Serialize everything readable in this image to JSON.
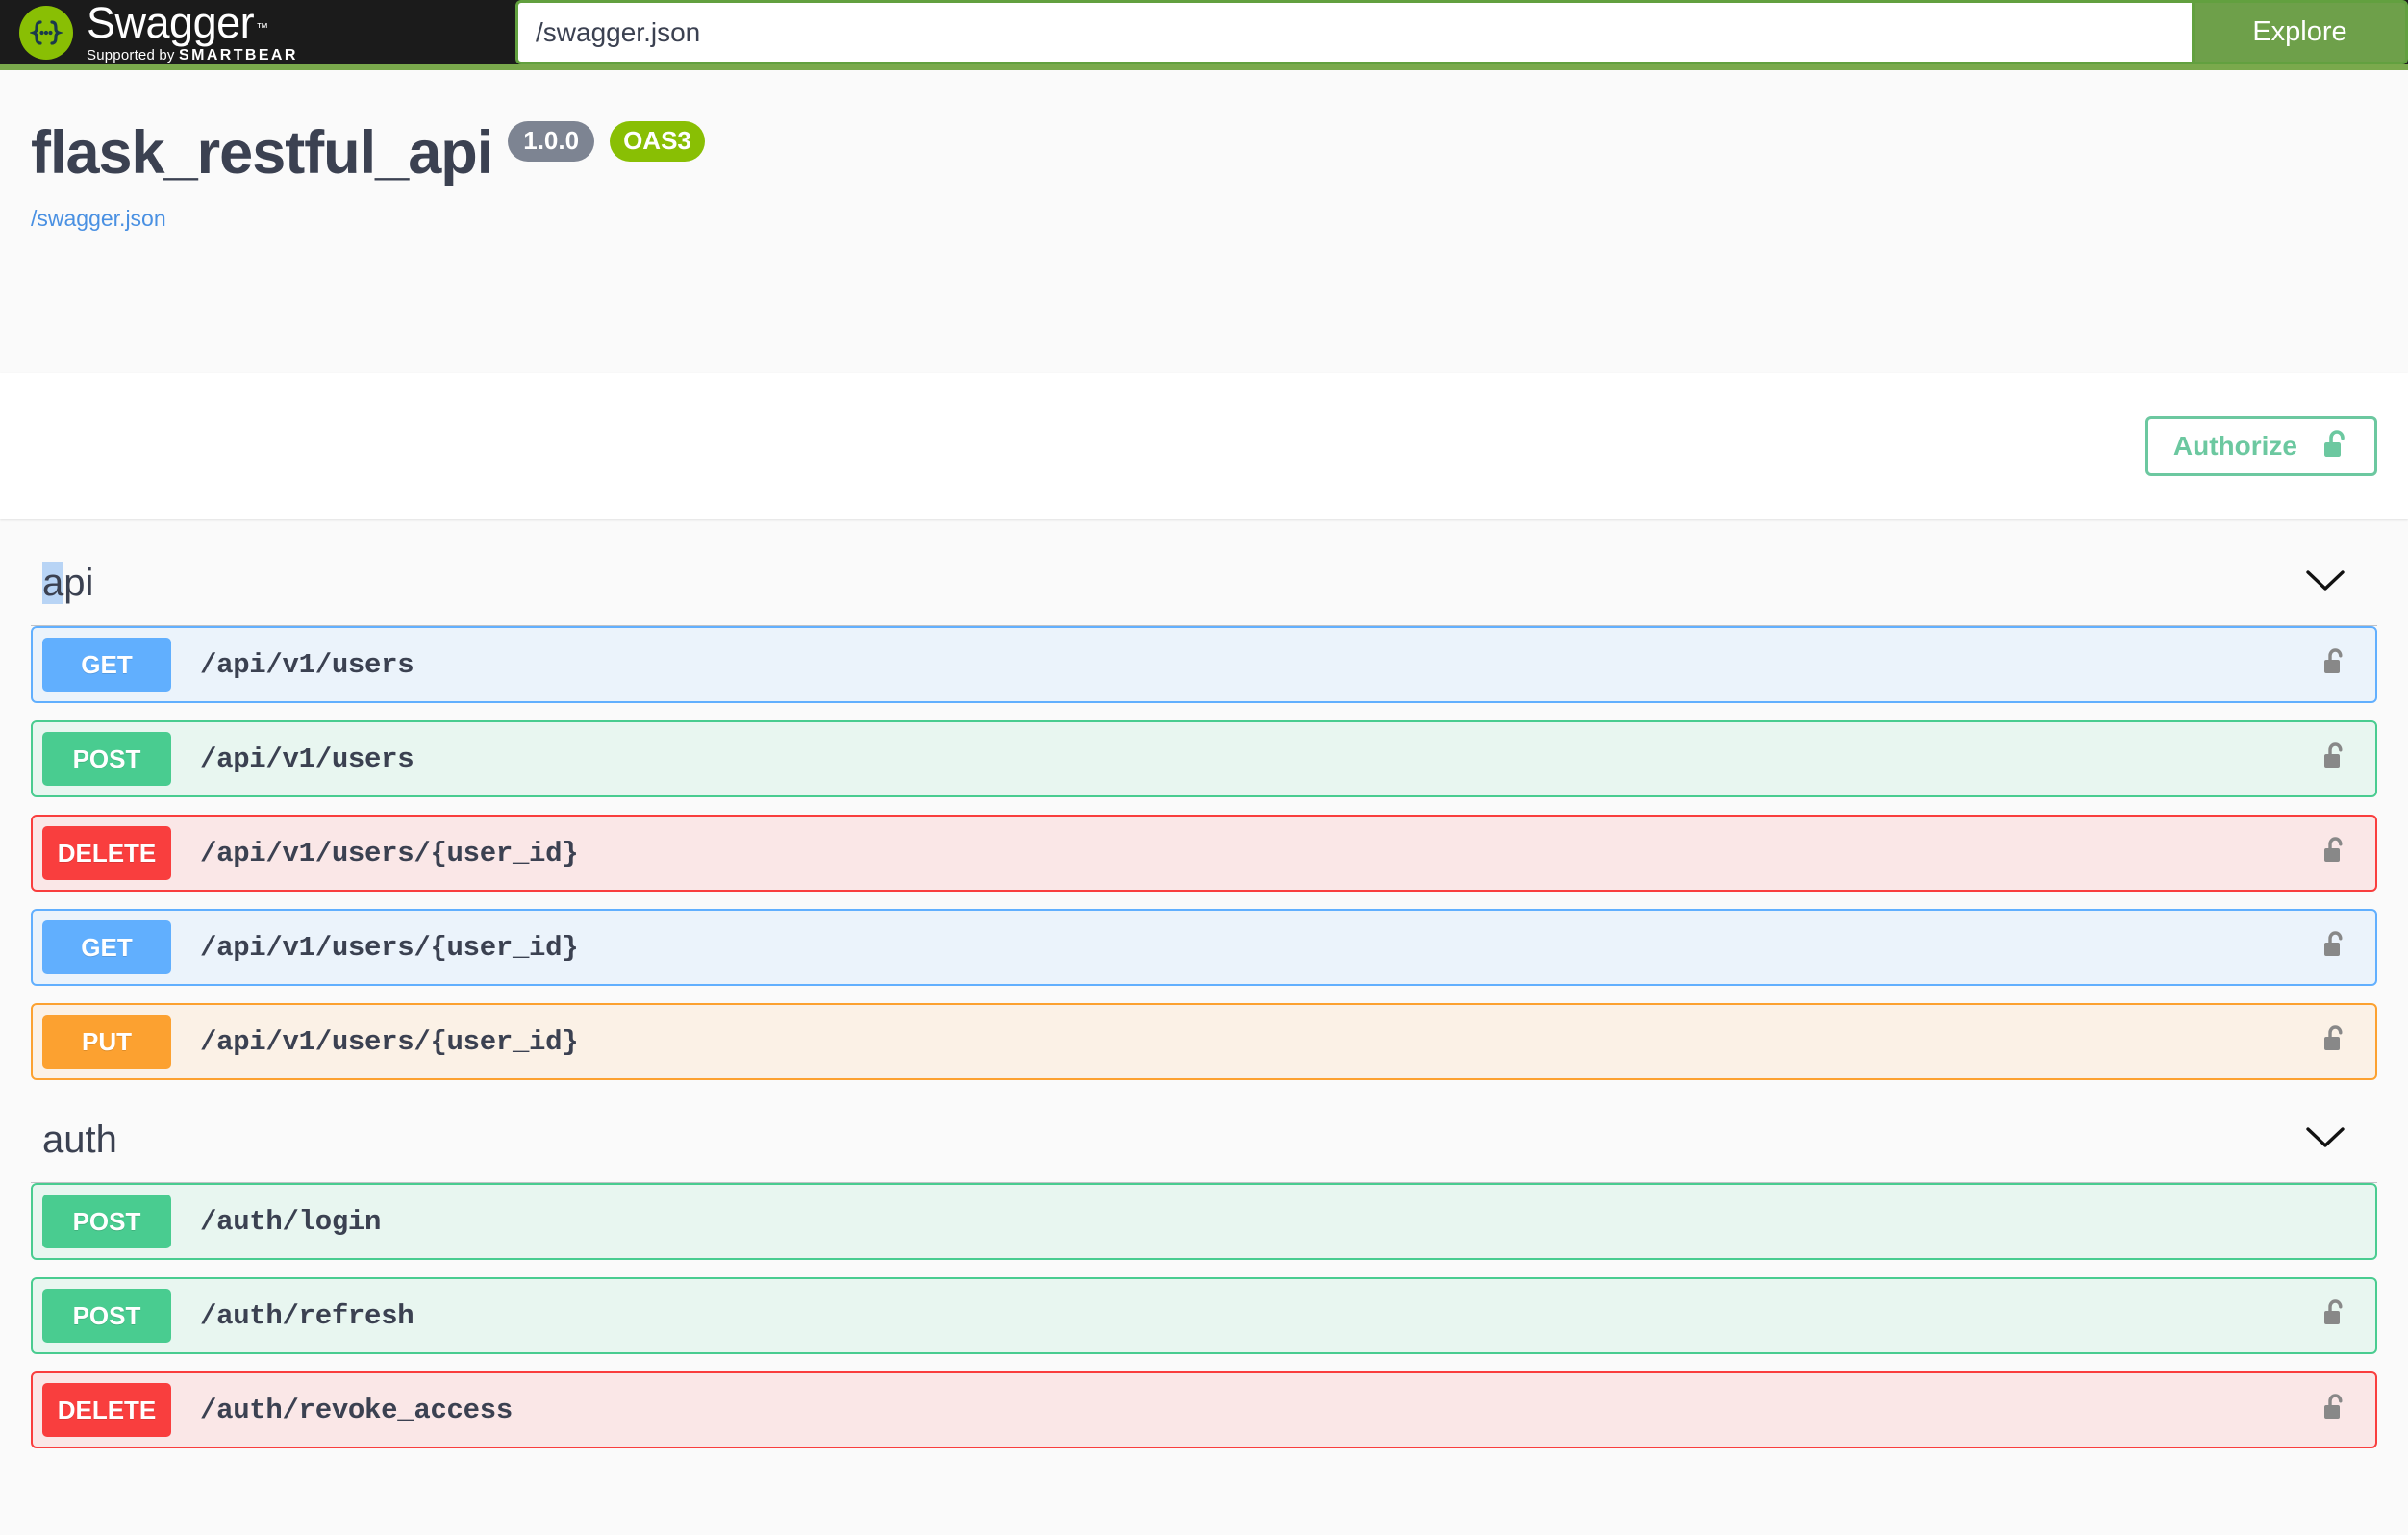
{
  "topbar": {
    "logo_word": "Swagger",
    "logo_tm": "™",
    "logo_sub_prefix": "Supported by",
    "logo_sub_brand": "SMARTBEAR",
    "url_value": "/swagger.json",
    "url_placeholder": "",
    "explore_label": "Explore"
  },
  "info": {
    "title": "flask_restful_api",
    "version_badge": "1.0.0",
    "spec_badge": "OAS3",
    "base_url": "/swagger.json"
  },
  "auth": {
    "authorize_label": "Authorize",
    "lock_icon": "unlock-icon"
  },
  "colors": {
    "topbar_bg": "#1b1b1b",
    "topbar_border": "#7aa94c",
    "brand_green": "#89bf04",
    "explore_green": "#6ea04a",
    "authorize_green": "#6cc8a0",
    "get": "#61affe",
    "post": "#49cc90",
    "delete": "#f93e3e",
    "put": "#fca130",
    "version_badge": "#7d8492",
    "text": "#3b4151",
    "link": "#4990e2",
    "selection_highlight": "#b8d4f5"
  },
  "sections": [
    {
      "tag": "api",
      "tag_selected_prefix": "a",
      "tag_rest": "pi",
      "chevron": "chevron-down-icon",
      "operations": [
        {
          "method": "GET",
          "method_class": "get",
          "path": "/api/v1/users",
          "lock": true
        },
        {
          "method": "POST",
          "method_class": "post",
          "path": "/api/v1/users",
          "lock": true
        },
        {
          "method": "DELETE",
          "method_class": "delete",
          "path": "/api/v1/users/{user_id}",
          "lock": true
        },
        {
          "method": "GET",
          "method_class": "get",
          "path": "/api/v1/users/{user_id}",
          "lock": true
        },
        {
          "method": "PUT",
          "method_class": "put",
          "path": "/api/v1/users/{user_id}",
          "lock": true
        }
      ]
    },
    {
      "tag": "auth",
      "tag_selected_prefix": "",
      "tag_rest": "auth",
      "chevron": "chevron-down-icon",
      "operations": [
        {
          "method": "POST",
          "method_class": "post",
          "path": "/auth/login",
          "lock": false
        },
        {
          "method": "POST",
          "method_class": "post",
          "path": "/auth/refresh",
          "lock": true
        },
        {
          "method": "DELETE",
          "method_class": "delete",
          "path": "/auth/revoke_access",
          "lock": true
        }
      ]
    }
  ]
}
